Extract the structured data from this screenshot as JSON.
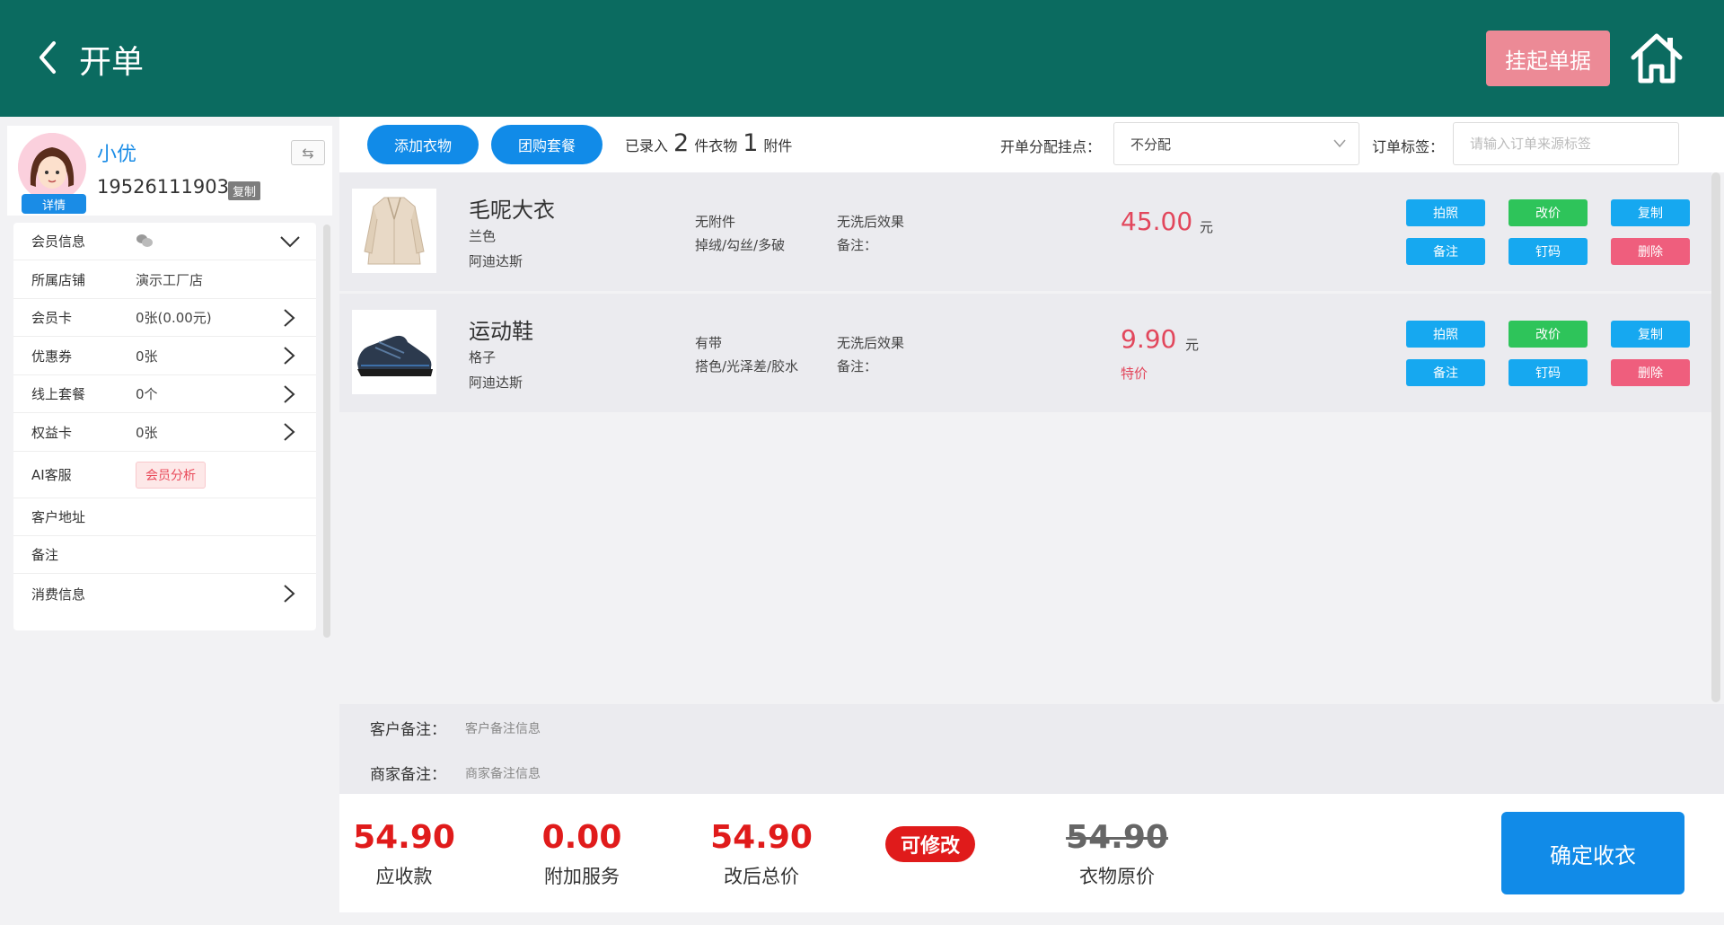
{
  "header": {
    "title": "开单",
    "hang_button": "挂起单据"
  },
  "user": {
    "name": "小优",
    "phone": "19526111903",
    "copy_label": "复制",
    "detail_label": "详情",
    "swap_icon": "⇆"
  },
  "info": {
    "member_info_label": "会员信息",
    "member_info_icon": "wechat-icon",
    "store_label": "所属店铺",
    "store_value": "演示工厂店",
    "card_label": "会员卡",
    "card_value": "0张(0.00元)",
    "coupon_label": "优惠券",
    "coupon_value": "0张",
    "package_label": "线上套餐",
    "package_value": "0个",
    "rights_label": "权益卡",
    "rights_value": "0张",
    "ai_label": "AI客服",
    "ai_tag": "会员分析",
    "address_label": "客户地址",
    "remark_label": "备注",
    "consume_label": "消费信息"
  },
  "topbar": {
    "add_clothes": "添加衣物",
    "group_package": "团购套餐",
    "entered_prefix": "已录入",
    "clothes_count": "2",
    "clothes_unit": "件衣物",
    "attach_count": "1",
    "attach_unit": "附件",
    "assign_label": "开单分配挂点：",
    "assign_value": "不分配",
    "tag_label": "订单标签：",
    "tag_placeholder": "请输入订单来源标签"
  },
  "items": [
    {
      "name": "毛呢大衣",
      "color": "兰色",
      "brand": "阿迪达斯",
      "attachment": "无附件",
      "defects": "掉绒/勾丝/多破",
      "effect": "无洗后效果",
      "remark": "备注：",
      "price": "45.00",
      "unit": "元",
      "special": ""
    },
    {
      "name": "运动鞋",
      "color": "格子",
      "brand": "阿迪达斯",
      "attachment": "有带",
      "defects": "搭色/光泽差/胶水",
      "effect": "无洗后效果",
      "remark": "备注：",
      "price": "9.90",
      "unit": "元",
      "special": "特价"
    }
  ],
  "item_actions": {
    "photo": "拍照",
    "change_price": "改价",
    "copy": "复制",
    "note": "备注",
    "tag_code": "钉码",
    "delete": "删除"
  },
  "remarks": {
    "customer_label": "客户备注：",
    "customer_value": "客户备注信息",
    "merchant_label": "商家备注：",
    "merchant_value": "商家备注信息"
  },
  "footer": {
    "receivable": "54.90",
    "receivable_label": "应收款",
    "extra": "0.00",
    "extra_label": "附加服务",
    "adjusted": "54.90",
    "adjusted_label": "改后总价",
    "modifiable": "可修改",
    "original": "54.90",
    "original_label": "衣物原价",
    "confirm": "确定收衣"
  },
  "colors": {
    "header_bg": "#0b6b60",
    "primary": "#118be8",
    "price_red": "#e2475c",
    "total_red": "#e01b1b",
    "hang_pink": "#ec8a96"
  }
}
